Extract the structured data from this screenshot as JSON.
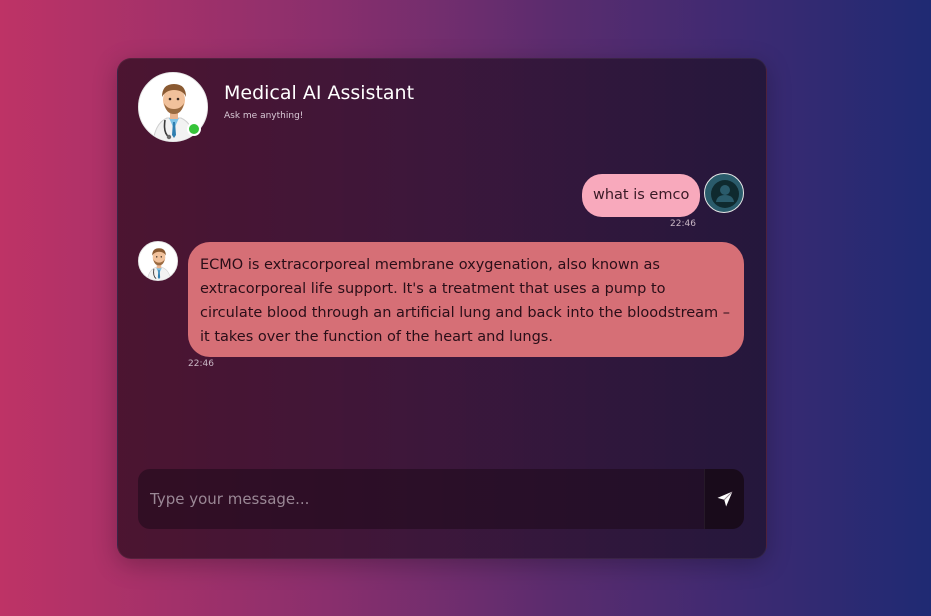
{
  "header": {
    "title": "Medical AI Assistant",
    "subtitle": "Ask me anything!",
    "status": "online"
  },
  "messages": [
    {
      "sender": "user",
      "text": "what is emco",
      "time": "22:46"
    },
    {
      "sender": "bot",
      "text": "ECMO is extracorporeal membrane oxygenation, also known as extracorporeal life support. It's a treatment that uses a pump to circulate blood through an artificial lung and back into the bloodstream – it takes over the function of the heart and lungs.",
      "time": "22:46"
    }
  ],
  "composer": {
    "placeholder": "Type your message...",
    "value": "",
    "send_icon": "send-icon"
  },
  "colors": {
    "user_bubble": "#f8a9bc",
    "bot_bubble": "#d66f76",
    "status_online": "#36c43a",
    "background_left": "#be3366",
    "background_right": "#1f2a73"
  }
}
